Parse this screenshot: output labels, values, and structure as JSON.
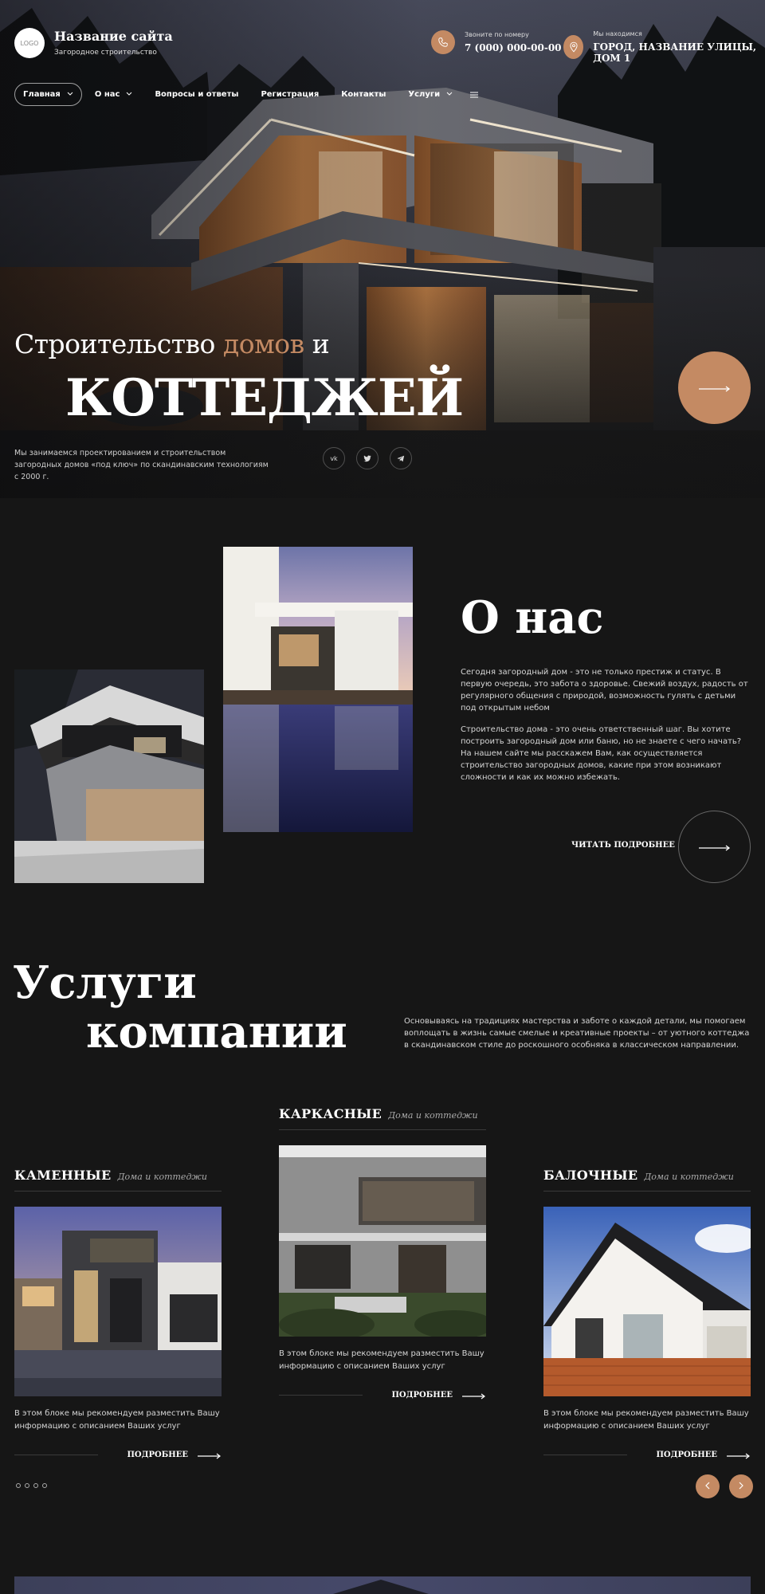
{
  "header": {
    "logo_text": "LOGO",
    "site_title": "Название сайта",
    "site_subtitle": "Загородное строительство",
    "phone_label": "Звоните по номеру",
    "phone_value": "7 (000) 000-00-00",
    "address_label": "Мы находимся",
    "address_value": "ГОРОД, НАЗВАНИЕ УЛИЦЫ, ДОМ 1",
    "phone_icon": "phone-icon",
    "location_icon": "location-pin-icon"
  },
  "nav": {
    "items": [
      {
        "label": "Главная",
        "dropdown": true
      },
      {
        "label": "О нас",
        "dropdown": true
      },
      {
        "label": "Вопросы и ответы",
        "dropdown": false
      },
      {
        "label": "Регистрация",
        "dropdown": false
      },
      {
        "label": "Контакты",
        "dropdown": false
      },
      {
        "label": "Услуги",
        "dropdown": true
      }
    ],
    "menu_icon": "hamburger-menu-icon"
  },
  "hero": {
    "line1_a": "Строительство ",
    "line1_accent": "домов",
    "line1_b": " и",
    "line2": "КОТТЕДЖЕЙ",
    "description": "Мы занимаемся проектированием и строительством загородных домов «под ключ» по скандинавским технологиям с 2000 г.",
    "socials": [
      "vk",
      "twitter",
      "telegram"
    ]
  },
  "about": {
    "title": "О нас",
    "paragraph1": "Сегодня загородный дом - это не только престиж и статус. В первую очередь, это забота о здоровье. Свежий воздух, радость от регулярного общения с природой, возможность гулять с детьми под открытым небом",
    "paragraph2": "Строительство дома - это очень ответственный шаг. Вы хотите построить загородный дом или баню, но не знаете с чего начать? На нашем сайте мы расскажем Вам, как осуществляется строительство загородных домов, какие при этом возникают сложности и как их можно избежать.",
    "more_label": "ЧИТАТЬ ПОДРОБНЕЕ"
  },
  "services": {
    "title_line1": "Услуги",
    "title_line2": "компании",
    "intro": "Основываясь на традициях мастерства и заботе о каждой детали, мы помогаем воплощать в жизнь самые смелые и креативные проекты – от уютного коттеджа в скандинавском стиле до роскошного особняка в классическом направлении.",
    "cards": [
      {
        "name": "КАМЕННЫЕ",
        "sub": "Дома и коттеджи",
        "desc": "В этом блоке мы рекомендуем разместить Вашу информацию с описанием Ваших услуг",
        "more": "ПОДРОБНЕЕ"
      },
      {
        "name": "КАРКАСНЫЕ",
        "sub": "Дома и коттеджи",
        "desc": "В этом блоке мы рекомендуем разместить Вашу информацию с описанием Ваших услуг",
        "more": "ПОДРОБНЕЕ"
      },
      {
        "name": "БАЛОЧНЫЕ",
        "sub": "Дома и коттеджи",
        "desc": "В этом блоке мы рекомендуем разместить Вашу информацию с описанием Ваших услуг",
        "more": "ПОДРОБНЕЕ"
      }
    ],
    "prev_icon": "chevron-left-icon",
    "next_icon": "chevron-right-icon",
    "slider_dots": 4
  },
  "colors": {
    "accent": "#c48a63",
    "background": "#161616",
    "text": "#ffffff"
  }
}
